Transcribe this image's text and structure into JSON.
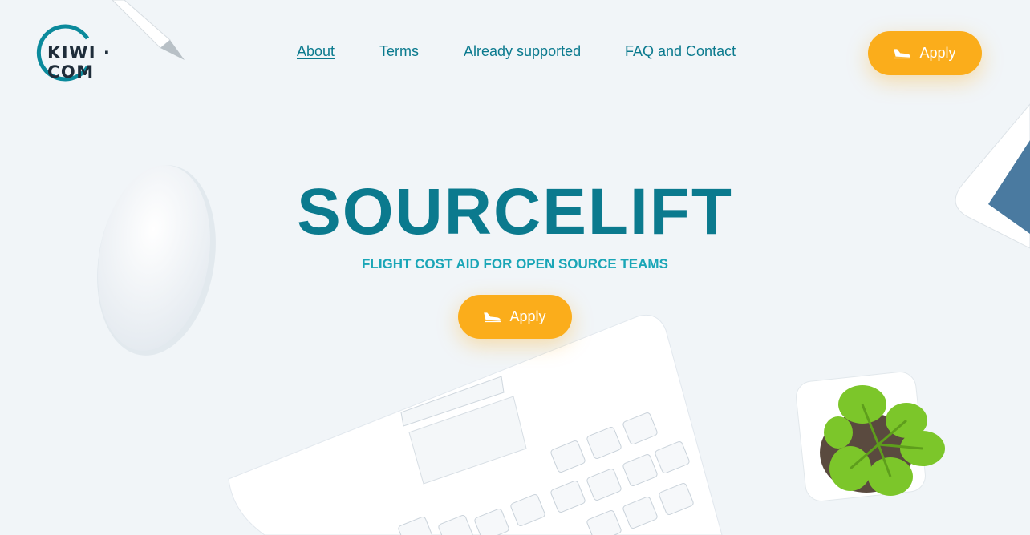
{
  "brand": {
    "logo_text": "KIWI · COM"
  },
  "nav": {
    "items": [
      {
        "label": "About",
        "active": true
      },
      {
        "label": "Terms"
      },
      {
        "label": "Already supported"
      },
      {
        "label": "FAQ and Contact"
      }
    ]
  },
  "header": {
    "apply_label": "Apply"
  },
  "hero": {
    "title": "SOURCELIFT",
    "subtitle": "FLIGHT COST AID FOR OPEN SOURCE TEAMS",
    "apply_label": "Apply"
  },
  "colors": {
    "accent": "#fbad1b",
    "brand": "#0b7a8e",
    "subtitle": "#1aa6b7",
    "background": "#f1f5f8"
  },
  "icons": {
    "apply": "plane-landing-icon"
  }
}
